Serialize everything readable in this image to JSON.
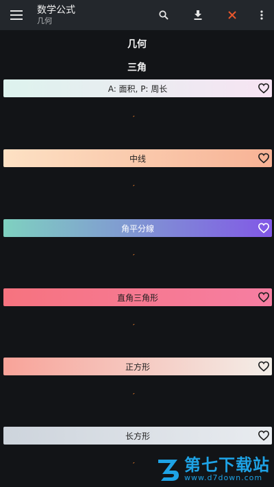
{
  "appbar": {
    "title": "数学公式",
    "subtitle": "几何",
    "icons": [
      "menu-icon",
      "search-icon",
      "download-icon",
      "close-icon",
      "more-vertical-icon"
    ],
    "close_color": "#e8572c"
  },
  "sections": {
    "geometry": "几何",
    "triangle": "三角"
  },
  "cards": [
    {
      "label": "A: 面积, P: 周长",
      "colors": [
        "#ddf3ee",
        "#f7e4f3"
      ],
      "light_text": false
    },
    {
      "label": "中线",
      "colors": [
        "#fde1c4",
        "#f7b295"
      ],
      "light_text": false
    },
    {
      "label": "角平分線",
      "colors": [
        "#7fd1c0",
        "#8158e6"
      ],
      "light_text": true
    },
    {
      "label": "直角三角形",
      "colors": [
        "#f6737f",
        "#f67ea2"
      ],
      "light_text": false
    },
    {
      "label": "正方形",
      "colors": [
        "#f8a399",
        "#f3eee8"
      ],
      "light_text": false
    },
    {
      "label": "长方形",
      "colors": [
        "#cdd4dc",
        "#e9ecf0"
      ],
      "light_text": false
    }
  ],
  "tick_mark": "′",
  "watermark": {
    "brand": "第七下载站",
    "url": "www.d7down.com",
    "color": "#1ea3e6"
  }
}
